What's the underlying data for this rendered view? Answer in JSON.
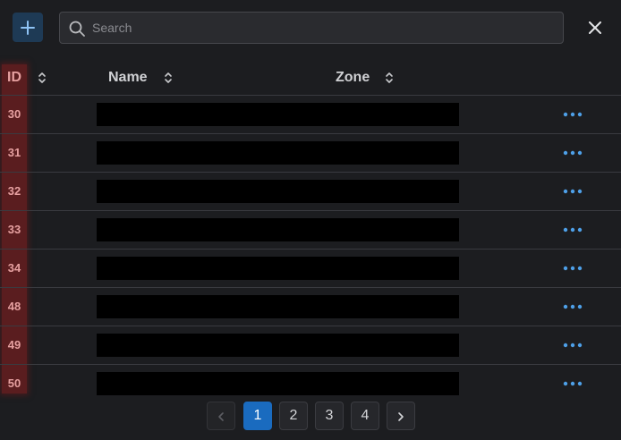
{
  "search": {
    "placeholder": "Search"
  },
  "table": {
    "columns": [
      {
        "label": "ID"
      },
      {
        "label": "Name"
      },
      {
        "label": "Zone"
      }
    ],
    "rows": [
      {
        "id": "30"
      },
      {
        "id": "31"
      },
      {
        "id": "32"
      },
      {
        "id": "33"
      },
      {
        "id": "34"
      },
      {
        "id": "48"
      },
      {
        "id": "49"
      },
      {
        "id": "50"
      }
    ]
  },
  "pagination": {
    "pages": [
      "1",
      "2",
      "3",
      "4"
    ],
    "current": "1"
  },
  "colors": {
    "accent": "#1a6bbf",
    "action_dots": "#4ea0e8",
    "id_highlight": "#5a1d1f"
  },
  "icons": {
    "add": "plus-icon",
    "search": "search-icon",
    "close": "close-icon",
    "sort": "sort-icon",
    "row_action": "more-horizontal-icon",
    "prev": "chevron-left-icon",
    "next": "chevron-right-icon"
  }
}
